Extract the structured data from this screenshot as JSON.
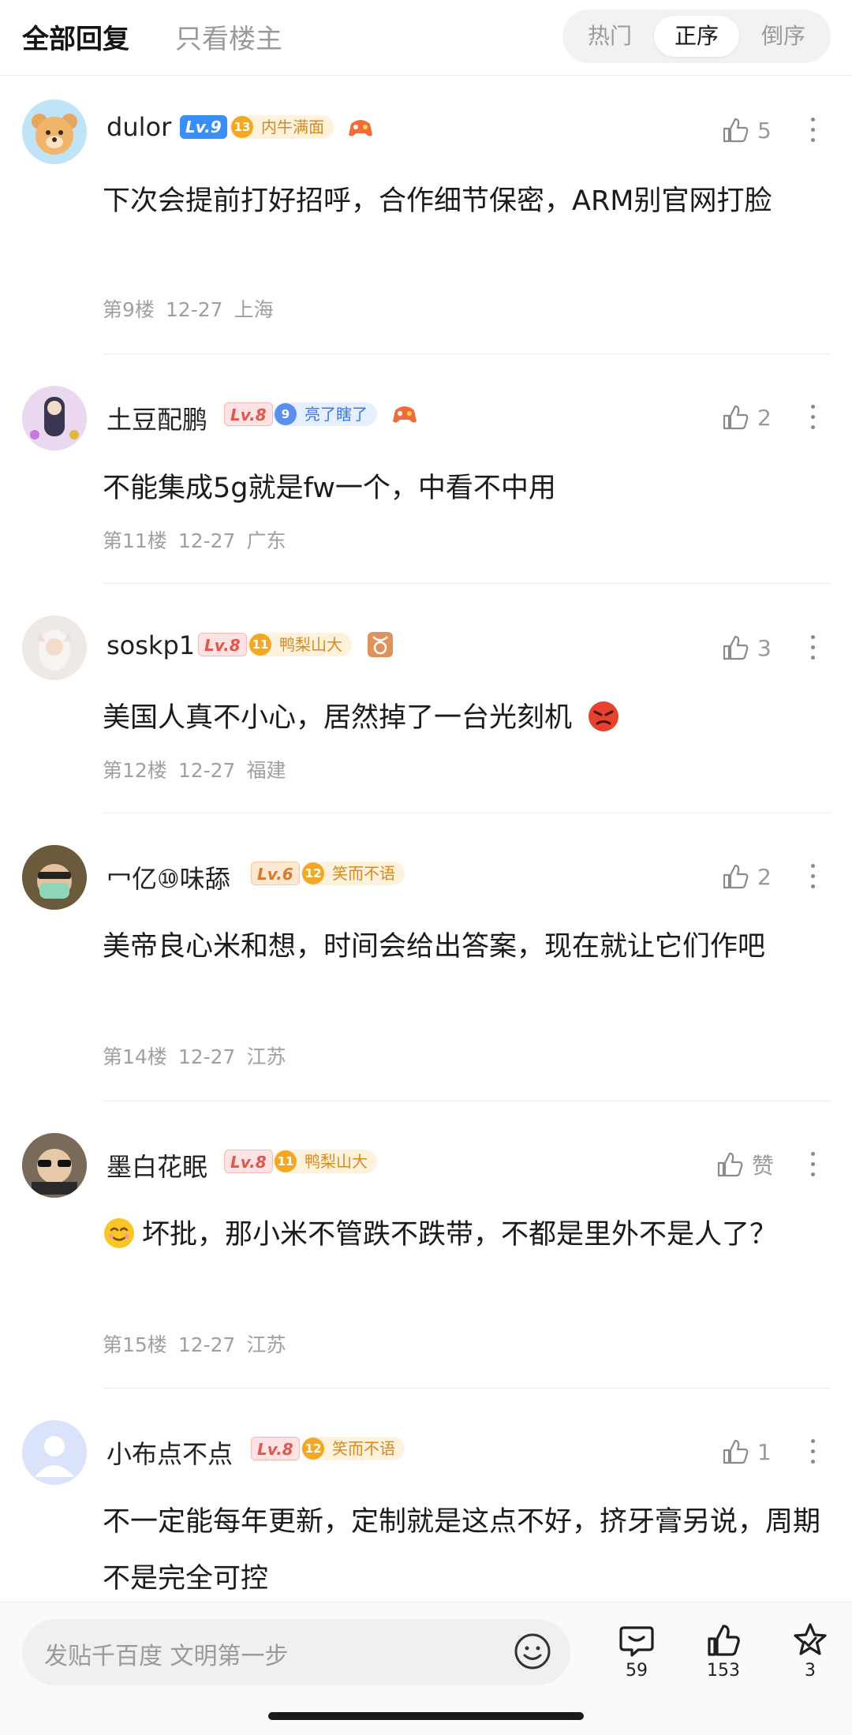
{
  "header": {
    "tab_all": "全部回复",
    "tab_op": "只看楼主",
    "sort_options": [
      "热门",
      "正序",
      "倒序"
    ],
    "sort_selected": "正序"
  },
  "comments": [
    {
      "username": "dulor",
      "level": "Lv.9",
      "fan_level": "13",
      "fan_title": "内牛满面",
      "likes": "5",
      "text": "下次会提前打好招呼，合作细节保密，ARM别官网打脸",
      "floor": "第9楼",
      "date": "12-27",
      "location": "上海"
    },
    {
      "username": "土豆配鹏",
      "level": "Lv.8",
      "fan_level": "9",
      "fan_title": "亮了瞎了",
      "likes": "2",
      "text": "不能集成5g就是fw一个，中看不中用",
      "floor": "第11楼",
      "date": "12-27",
      "location": "广东"
    },
    {
      "username": "soskp1",
      "level": "Lv.8",
      "fan_level": "11",
      "fan_title": "鸭梨山大",
      "likes": "3",
      "text": "美国人真不小心，居然掉了一台光刻机",
      "floor": "第12楼",
      "date": "12-27",
      "location": "福建"
    },
    {
      "username": "冖亿⑩味舔",
      "level": "Lv.6",
      "fan_level": "12",
      "fan_title": "笑而不语",
      "likes": "2",
      "text": "美帝良心米和想，时间会给出答案，现在就让它们作吧",
      "floor": "第14楼",
      "date": "12-27",
      "location": "江苏"
    },
    {
      "username": "墨白花眠",
      "level": "Lv.8",
      "fan_level": "11",
      "fan_title": "鸭梨山大",
      "likes": "赞",
      "text": "坏批，那小米不管跌不跌带，不都是里外不是人了？",
      "floor": "第15楼",
      "date": "12-27",
      "location": "江苏"
    },
    {
      "username": "小布点不点",
      "level": "Lv.8",
      "fan_level": "12",
      "fan_title": "笑而不语",
      "likes": "1",
      "text": "不一定能每年更新，定制就是这点不好，挤牙膏另说，周期不是完全可控"
    }
  ],
  "bottom": {
    "input_placeholder": "发贴千百度 文明第一步",
    "comment_count": "59",
    "like_count": "153",
    "fav_count": "3"
  },
  "colors": {
    "level_blue": "#3a8ff7",
    "level_red": "#e2574c",
    "fan_gold": "#f3a825",
    "fan_blue": "#5a8ff0",
    "muted": "#9a9a9a"
  }
}
